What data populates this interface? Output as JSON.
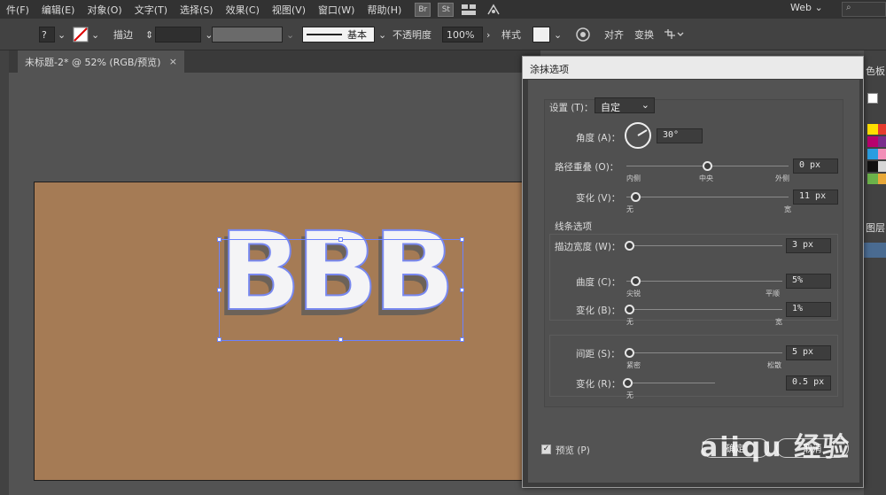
{
  "menubar": {
    "items": [
      "件(F)",
      "编辑(E)",
      "对象(O)",
      "文字(T)",
      "选择(S)",
      "效果(C)",
      "视图(V)",
      "窗口(W)",
      "帮助(H)"
    ],
    "app_badges": [
      "Br",
      "St"
    ],
    "workspace": "Web",
    "search_icon": "search-icon"
  },
  "controlbar": {
    "stroke_label": "描边",
    "stroke_style": "基本",
    "opacity_label": "不透明度",
    "opacity_value": "100%",
    "style_label": "样式",
    "align_label": "对齐",
    "transform_label": "变换"
  },
  "document": {
    "tab_title": "未标题-2* @ 52% (RGB/预览)",
    "close_icon": "×",
    "canvas_text": "BBB"
  },
  "right_panel": {
    "label_1": "色板",
    "label_2": "图层"
  },
  "dialog": {
    "title": "涂抹选项",
    "settings_label": "设置 (T)：",
    "settings_value": "自定",
    "angle_label": "角度 (A)：",
    "angle_value": "30°",
    "path_overlap_label": "路径重叠 (O)：",
    "path_overlap_value": "0 px",
    "path_overlap_inside": "内侧",
    "path_overlap_center": "中央",
    "path_overlap_outside": "外侧",
    "variation_v_label": "变化 (V)：",
    "variation_v_value": "11 px",
    "variation_v_min": "无",
    "variation_v_max": "宽",
    "line_options_label": "线条选项",
    "stroke_width_label": "描边宽度 (W)：",
    "stroke_width_value": "3 px",
    "curviness_label": "曲度 (C)：",
    "curviness_value": "5%",
    "curviness_min": "尖锐",
    "curviness_max": "平顺",
    "variation_b_label": "变化 (B)：",
    "variation_b_value": "1%",
    "variation_b_min": "无",
    "variation_b_max": "宽",
    "spacing_label": "间距 (S)：",
    "spacing_value": "5 px",
    "spacing_min": "紧密",
    "spacing_max": "松散",
    "variation_r_label": "变化 (R)：",
    "variation_r_value": "0.5 px",
    "variation_r_min": "无",
    "preview_label": "预览 (P)",
    "ok_label": "确定",
    "cancel_label": "取消",
    "slider_levels": {
      "path_overlap": 0.5,
      "variation_v": 0.06,
      "stroke_width": 0.02,
      "curviness": 0.05,
      "variation_b": 0.01,
      "spacing": 0.03,
      "variation_r": 0.0
    }
  },
  "watermark": "aiiqu 经验"
}
